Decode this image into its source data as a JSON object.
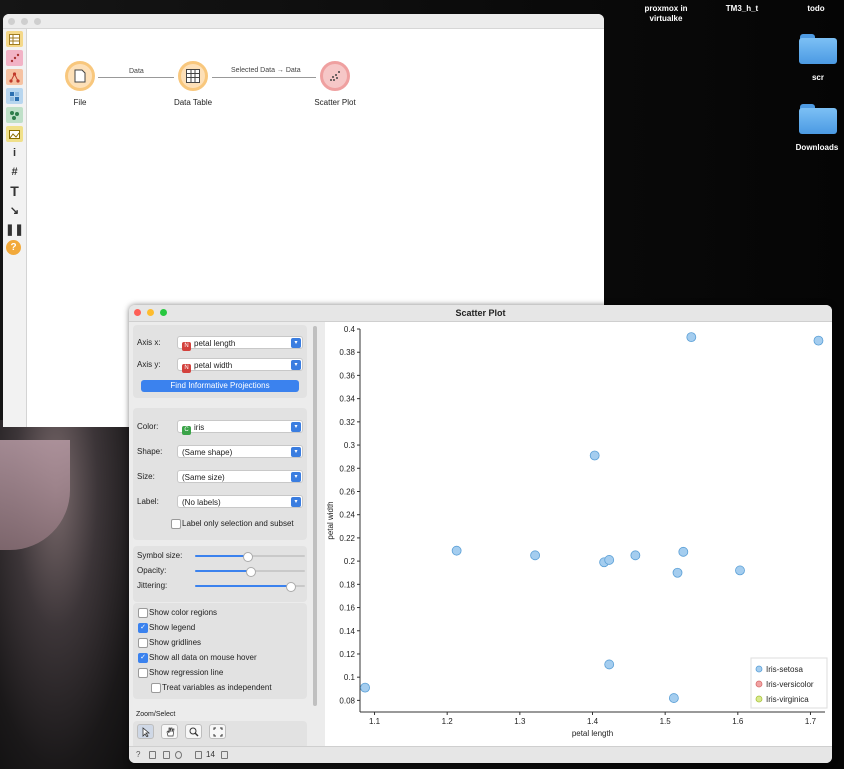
{
  "desktop": {
    "items": [
      "proxmox in virtualke",
      "TM3_h_t",
      "todo",
      "scr",
      "Downloads"
    ]
  },
  "canvas": {
    "nodes": [
      {
        "label": "File",
        "icon": "file-icon"
      },
      {
        "label": "Data Table",
        "icon": "table-icon"
      },
      {
        "label": "Scatter Plot",
        "icon": "scatter-icon"
      }
    ],
    "links": [
      "Data",
      "Selected Data → Data"
    ]
  },
  "scatter": {
    "title": "Scatter Plot",
    "axis_x_label": "Axis x:",
    "axis_x_value": "petal length",
    "axis_y_label": "Axis y:",
    "axis_y_value": "petal width",
    "var_tag": "N",
    "find_button": "Find Informative Projections",
    "color_label": "Color:",
    "color_value": "iris",
    "color_tag": "C",
    "shape_label": "Shape:",
    "shape_value": "(Same shape)",
    "size_label": "Size:",
    "size_value": "(Same size)",
    "label_label": "Label:",
    "label_value": "(No labels)",
    "label_only_sel": "Label only selection and subset",
    "symbol_size": "Symbol size:",
    "opacity": "Opacity:",
    "jittering": "Jittering:",
    "symbol_size_level": 0.47,
    "opacity_level": 0.5,
    "jittering_level": 0.86,
    "options": [
      {
        "label": "Show color regions",
        "checked": false
      },
      {
        "label": "Show legend",
        "checked": true
      },
      {
        "label": "Show gridlines",
        "checked": false
      },
      {
        "label": "Show all data on mouse hover",
        "checked": true
      },
      {
        "label": "Show regression line",
        "checked": false
      },
      {
        "label": "Treat variables as independent",
        "checked": false
      }
    ],
    "zoom_select": "Zoom/Select",
    "status_count": "14",
    "colors": {
      "setosa": "#a4cdef",
      "versicolor": "#f0a3a3",
      "virginica": "#d8ea8c",
      "accent": "#3b82ee"
    }
  },
  "chart_data": {
    "type": "scatter",
    "xlabel": "petal length",
    "ylabel": "petal width",
    "xlim": [
      1.08,
      1.72
    ],
    "ylim": [
      0.07,
      0.4
    ],
    "xticks": [
      "1.1",
      "1.2",
      "1.3",
      "1.4",
      "1.5",
      "1.6",
      "1.7"
    ],
    "yticks": [
      "0.08",
      "0.1",
      "0.12",
      "0.14",
      "0.16",
      "0.18",
      "0.2",
      "0.22",
      "0.24",
      "0.26",
      "0.28",
      "0.3",
      "0.32",
      "0.34",
      "0.36",
      "0.38",
      "0.4"
    ],
    "legend": [
      "Iris-setosa",
      "Iris-versicolor",
      "Iris-virginica"
    ],
    "legend_position": "bottom-right",
    "grid": false,
    "series": [
      {
        "name": "Iris-setosa",
        "points": [
          [
            1.087,
            0.091
          ],
          [
            1.213,
            0.209
          ],
          [
            1.321,
            0.205
          ],
          [
            1.403,
            0.291
          ],
          [
            1.416,
            0.199
          ],
          [
            1.423,
            0.201
          ],
          [
            1.459,
            0.205
          ],
          [
            1.423,
            0.111
          ],
          [
            1.512,
            0.082
          ],
          [
            1.517,
            0.19
          ],
          [
            1.525,
            0.208
          ],
          [
            1.536,
            0.393
          ],
          [
            1.603,
            0.192
          ],
          [
            1.711,
            0.39
          ]
        ]
      }
    ]
  }
}
